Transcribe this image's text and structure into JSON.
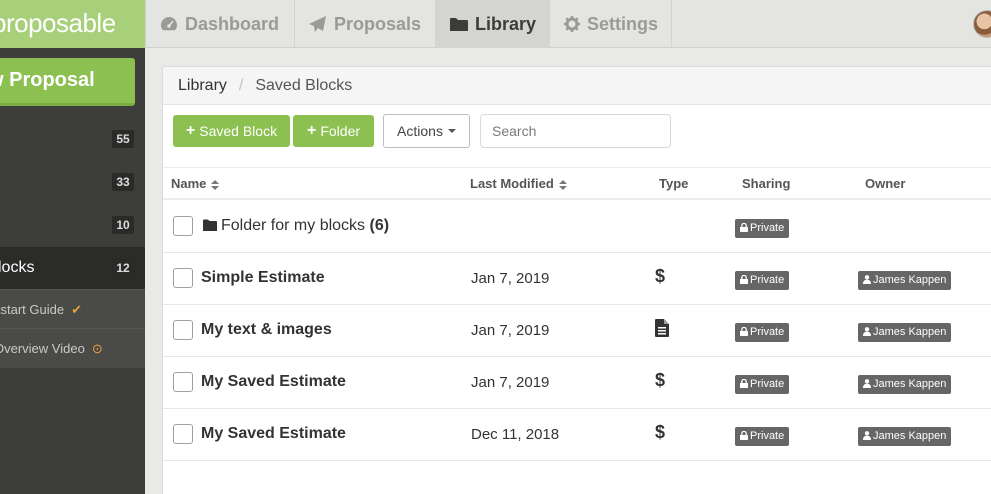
{
  "app": {
    "logo_text": "proposable"
  },
  "nav": {
    "tabs": [
      {
        "label": "Dashboard",
        "icon": "dashboard-icon"
      },
      {
        "label": "Proposals",
        "icon": "paper-plane-icon"
      },
      {
        "label": "Library",
        "icon": "folder-icon",
        "active": true
      },
      {
        "label": "Settings",
        "icon": "gear-icon"
      }
    ]
  },
  "sidebar": {
    "new_proposal_label": "w Proposal",
    "counts": [
      "55",
      "33",
      "10"
    ],
    "active_item": {
      "label": "locks",
      "count": "12"
    },
    "links": [
      {
        "label": "kstart Guide",
        "icon": "checkmark-icon",
        "glyph": "✔"
      },
      {
        "label": "Overview Video",
        "icon": "play-icon",
        "glyph": "⊙"
      }
    ]
  },
  "breadcrumb": {
    "root": "Library",
    "separator": "/",
    "current": "Saved Blocks"
  },
  "toolbar": {
    "saved_block_label": "Saved Block",
    "folder_label": "Folder",
    "actions_label": "Actions",
    "search_placeholder": "Search"
  },
  "table": {
    "columns": {
      "name": "Name",
      "modified": "Last Modified",
      "type": "Type",
      "sharing": "Sharing",
      "owner": "Owner"
    },
    "folder_row": {
      "name": "Folder for my blocks",
      "count": "(6)",
      "sharing": "Private"
    },
    "rows": [
      {
        "name": "Simple Estimate",
        "modified": "Jan 7, 2019",
        "type_glyph": "$",
        "type_icon": "dollar-icon",
        "sharing": "Private",
        "owner": "James Kappen"
      },
      {
        "name": "My text & images",
        "modified": "Jan 7, 2019",
        "type_glyph": "",
        "type_icon": "document-icon",
        "sharing": "Private",
        "owner": "James Kappen"
      },
      {
        "name": "My Saved Estimate",
        "modified": "Jan 7, 2019",
        "type_glyph": "$",
        "type_icon": "dollar-icon",
        "sharing": "Private",
        "owner": "James Kappen"
      },
      {
        "name": "My Saved Estimate",
        "modified": "Dec 11, 2018",
        "type_glyph": "$",
        "type_icon": "dollar-icon",
        "sharing": "Private",
        "owner": "James Kappen"
      }
    ]
  },
  "colors": {
    "brand_green": "#8cc152",
    "sidebar_dark": "#3d3d3b",
    "badge_gray": "#666666"
  }
}
